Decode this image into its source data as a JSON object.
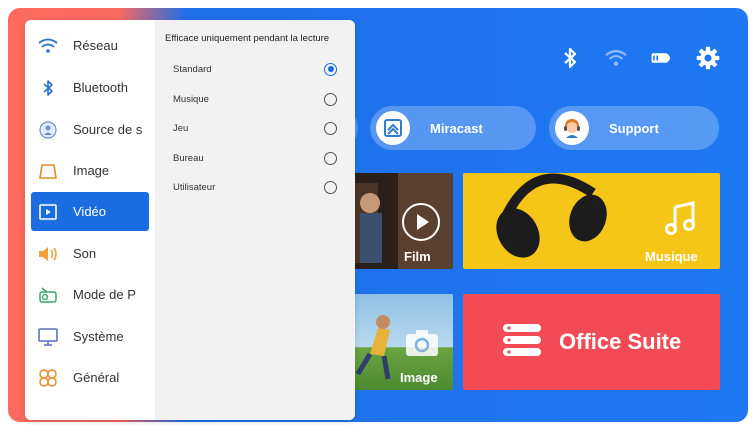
{
  "status_icons": [
    "bluetooth-icon",
    "wifi-icon",
    "projector-icon",
    "settings-gear-icon"
  ],
  "pills": {
    "miracast": "Miracast",
    "support": "Support"
  },
  "tiles": {
    "film": "Film",
    "musique": "Musique",
    "image": "Image",
    "office": "Office Suite"
  },
  "menu": {
    "items": [
      {
        "label": "Réseau",
        "icon": "wifi-icon"
      },
      {
        "label": "Bluetooth",
        "icon": "bluetooth-icon"
      },
      {
        "label": "Source de s",
        "icon": "source-icon"
      },
      {
        "label": "Image",
        "icon": "image-icon"
      },
      {
        "label": "Vidéo",
        "icon": "video-icon"
      },
      {
        "label": "Son",
        "icon": "speaker-icon"
      },
      {
        "label": "Mode de P",
        "icon": "projection-mode-icon"
      },
      {
        "label": "Système",
        "icon": "monitor-icon"
      },
      {
        "label": "Général",
        "icon": "general-icon"
      }
    ],
    "active_index": 4
  },
  "submenu": {
    "title": "Efficace uniquement pendant la lecture",
    "options": [
      "Standard",
      "Musique",
      "Jeu",
      "Bureau",
      "Utilisateur"
    ],
    "selected": "Standard"
  },
  "colors": {
    "accent": "#1a6de0",
    "background_blue": "#1f74ee",
    "office_red": "#f24b55",
    "music_yellow": "#f5c518"
  }
}
